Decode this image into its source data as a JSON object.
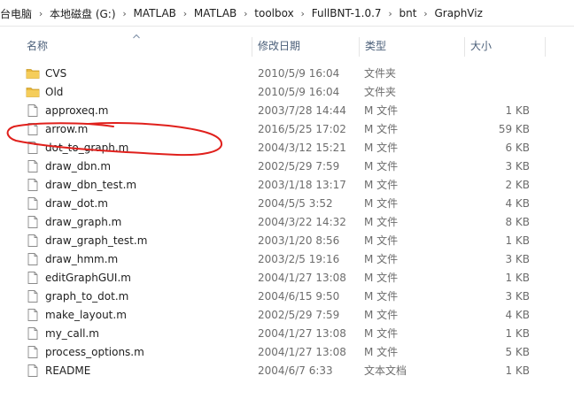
{
  "breadcrumb": {
    "items": [
      "台电脑",
      "本地磁盘 (G:)",
      "MATLAB",
      "MATLAB",
      "toolbox",
      "FullBNT-1.0.7",
      "bnt",
      "GraphViz"
    ]
  },
  "columns": {
    "name": "名称",
    "date": "修改日期",
    "type": "类型",
    "size": "大小"
  },
  "files": [
    {
      "name": "CVS",
      "date": "2010/5/9 16:04",
      "type": "文件夹",
      "size": "",
      "kind": "folder"
    },
    {
      "name": "Old",
      "date": "2010/5/9 16:04",
      "type": "文件夹",
      "size": "",
      "kind": "folder"
    },
    {
      "name": "approxeq.m",
      "date": "2003/7/28 14:44",
      "type": "M 文件",
      "size": "1 KB",
      "kind": "file"
    },
    {
      "name": "arrow.m",
      "date": "2016/5/25 17:02",
      "type": "M 文件",
      "size": "59 KB",
      "kind": "file"
    },
    {
      "name": "dot_to_graph.m",
      "date": "2004/3/12 15:21",
      "type": "M 文件",
      "size": "6 KB",
      "kind": "file"
    },
    {
      "name": "draw_dbn.m",
      "date": "2002/5/29 7:59",
      "type": "M 文件",
      "size": "3 KB",
      "kind": "file"
    },
    {
      "name": "draw_dbn_test.m",
      "date": "2003/1/18 13:17",
      "type": "M 文件",
      "size": "2 KB",
      "kind": "file"
    },
    {
      "name": "draw_dot.m",
      "date": "2004/5/5 3:52",
      "type": "M 文件",
      "size": "4 KB",
      "kind": "file"
    },
    {
      "name": "draw_graph.m",
      "date": "2004/3/22 14:32",
      "type": "M 文件",
      "size": "8 KB",
      "kind": "file"
    },
    {
      "name": "draw_graph_test.m",
      "date": "2003/1/20 8:56",
      "type": "M 文件",
      "size": "1 KB",
      "kind": "file"
    },
    {
      "name": "draw_hmm.m",
      "date": "2003/2/5 19:16",
      "type": "M 文件",
      "size": "3 KB",
      "kind": "file"
    },
    {
      "name": "editGraphGUI.m",
      "date": "2004/1/27 13:08",
      "type": "M 文件",
      "size": "1 KB",
      "kind": "file"
    },
    {
      "name": "graph_to_dot.m",
      "date": "2004/6/15 9:50",
      "type": "M 文件",
      "size": "3 KB",
      "kind": "file"
    },
    {
      "name": "make_layout.m",
      "date": "2002/5/29 7:59",
      "type": "M 文件",
      "size": "4 KB",
      "kind": "file"
    },
    {
      "name": "my_call.m",
      "date": "2004/1/27 13:08",
      "type": "M 文件",
      "size": "1 KB",
      "kind": "file"
    },
    {
      "name": "process_options.m",
      "date": "2004/1/27 13:08",
      "type": "M 文件",
      "size": "5 KB",
      "kind": "file"
    },
    {
      "name": "README",
      "date": "2004/6/7 6:33",
      "type": "文本文档",
      "size": "1 KB",
      "kind": "file"
    }
  ],
  "colors": {
    "folder": "#e8b73e",
    "annotation": "#e0201c",
    "header_text": "#4c607a"
  },
  "icons": {
    "folder": "folder-icon",
    "file": "document-icon",
    "sort": "sort-ascending-icon",
    "separator": "chevron-right-icon"
  }
}
